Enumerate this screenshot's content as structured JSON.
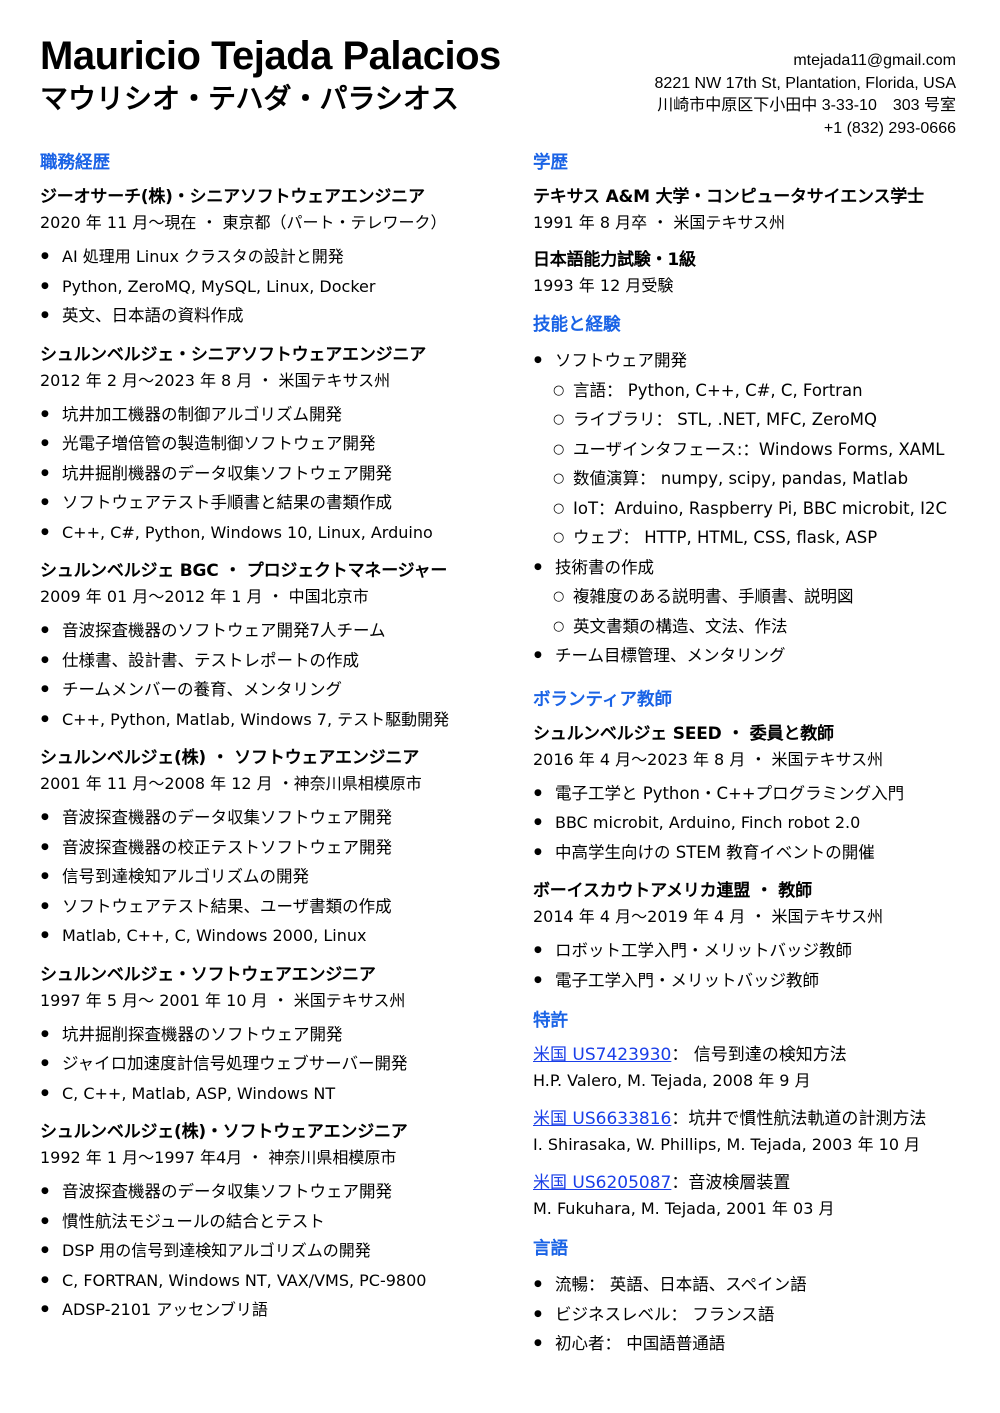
{
  "header": {
    "name": "Mauricio Tejada Palacios",
    "name_jp": "マウリシオ・テハダ・パラシオス",
    "email": "mtejada11@gmail.com",
    "address_us": "8221 NW 17th St, Plantation, Florida, USA",
    "address_jp": "川崎市中原区下小田中 3-33-10　303 号室",
    "phone": "+1 (832) 293-0666"
  },
  "work": {
    "title": "職務経歴",
    "entries": [
      {
        "title": "ジーオサーチ(株)・シニアソフトウェアエンジニア",
        "meta": "2020 年 11 月～現在 ・ 東京都（パート・テレワーク）",
        "items": [
          "AI 処理用 Linux クラスタの設計と開発",
          "Python, ZeroMQ, MySQL, Linux, Docker",
          "英文、日本語の資料作成"
        ]
      },
      {
        "title": "シュルンベルジェ・シニアソフトウェアエンジニア",
        "meta": "2012 年 2 月～2023 年 8 月 ・ 米国テキサス州",
        "items": [
          "坑井加工機器の制御アルゴリズム開発",
          "光電子増倍管の製造制御ソフトウェア開発",
          "坑井掘削機器のデータ収集ソフトウェア開発",
          "ソフトウェアテスト手順書と結果の書類作成",
          "C++, C#, Python, Windows 10, Linux, Arduino"
        ]
      },
      {
        "title": "シュルンベルジェ BGC ・ プロジェクトマネージャー",
        "meta": "2009 年 01 月～2012 年 1 月 ・ 中国北京市",
        "items": [
          "音波探査機器のソフトウェア開発7人チーム",
          "仕様書、設計書、テストレポートの作成",
          "チームメンバーの養育、メンタリング",
          "C++, Python, Matlab, Windows 7, テスト駆動開発"
        ]
      },
      {
        "title": "シュルンベルジェ(株) ・ ソフトウェアエンジニア",
        "meta": "2001 年 11 月～2008 年 12 月 ・神奈川県相模原市",
        "items": [
          "音波探査機器のデータ収集ソフトウェア開発",
          "音波探査機器の校正テストソフトウェア開発",
          "信号到達検知アルゴリズムの開発",
          "ソフトウェアテスト結果、ユーザ書類の作成",
          "Matlab, C++, C, Windows 2000, Linux"
        ]
      },
      {
        "title": "シュルンベルジェ・ソフトウェアエンジニア",
        "meta": "1997 年 5 月～ 2001 年 10 月 ・ 米国テキサス州",
        "items": [
          "坑井掘削探査機器のソフトウェア開発",
          "ジャイロ加速度計信号処理ウェブサーバー開発",
          "C, C++, Matlab, ASP, Windows NT"
        ]
      },
      {
        "title": "シュルンベルジェ(株)・ソフトウェアエンジニア",
        "meta": "1992 年 1 月～1997 年4月 ・ 神奈川県相模原市",
        "items": [
          "音波探査機器のデータ収集ソフトウェア開発",
          "慣性航法モジュールの結合とテスト",
          "DSP 用の信号到達検知アルゴリズムの開発",
          "C, FORTRAN, Windows NT, VAX/VMS, PC-9800",
          "ADSP-2101 アッセンブリ語"
        ]
      }
    ]
  },
  "education": {
    "title": "学歴",
    "entries": [
      {
        "title": "テキサス A&M 大学・コンピュータサイエンス学士",
        "meta": "1991 年 8 月卒 ・ 米国テキサス州"
      },
      {
        "title": "日本語能力試験・1級",
        "meta": "1993 年 12 月受験"
      }
    ]
  },
  "skills": {
    "title": "技能と経験",
    "items": [
      {
        "text": "ソフトウェア開発",
        "sub": [
          "言語： Python, C++, C#, C, Fortran",
          "ライブラリ： STL, .NET, MFC, ZeroMQ",
          "ユーザインタフェース:：Windows Forms, XAML",
          "数値演算： numpy, scipy, pandas, Matlab",
          "IoT：Arduino, Raspberry Pi, BBC microbit, I2C",
          "ウェブ： HTTP, HTML, CSS, flask, ASP"
        ]
      },
      {
        "text": "技術書の作成",
        "sub": [
          "複雑度のある説明書、手順書、説明図",
          "英文書類の構造、文法、作法"
        ]
      },
      {
        "text": "チーム目標管理、メンタリング",
        "sub": []
      }
    ]
  },
  "volunteer": {
    "title": "ボランティア教師",
    "entries": [
      {
        "title": "シュルンベルジェ SEED ・ 委員と教師",
        "meta": "2016 年 4 月～2023 年 8 月 ・ 米国テキサス州",
        "items": [
          "電子工学と Python・C++プログラミング入門",
          "BBC microbit, Arduino, Finch robot 2.0",
          "中高学生向けの STEM 教育イベントの開催"
        ]
      },
      {
        "title": "ボーイスカウトアメリカ連盟 ・ 教師",
        "meta": "2014 年 4 月～2019 年 4 月 ・ 米国テキサス州",
        "items": [
          "ロボット工学入門・メリットバッジ教師",
          "電子工学入門・メリットバッジ教師"
        ]
      }
    ]
  },
  "patents": {
    "title": "特許",
    "entries": [
      {
        "link": "米国 US7423930",
        "desc": "： 信号到達の検知方法",
        "authors": "H.P. Valero, M. Tejada, 2008 年 9 月"
      },
      {
        "link": "米国 US6633816",
        "desc": "：坑井で慣性航法軌道の計測方法",
        "authors": "I. Shirasaka, W. Phillips, M. Tejada, 2003 年 10 月"
      },
      {
        "link": "米国 US6205087",
        "desc": "：音波検層装置",
        "authors": "M. Fukuhara, M. Tejada, 2001 年 03 月"
      }
    ]
  },
  "languages": {
    "title": "言語",
    "items": [
      "流暢： 英語、日本語、スペイン語",
      "ビジネスレベル： フランス語",
      "初心者： 中国語普通語"
    ]
  },
  "colors": {
    "section_heading": "#1a63e6",
    "link": "#1a3fe8",
    "text": "#000000"
  }
}
